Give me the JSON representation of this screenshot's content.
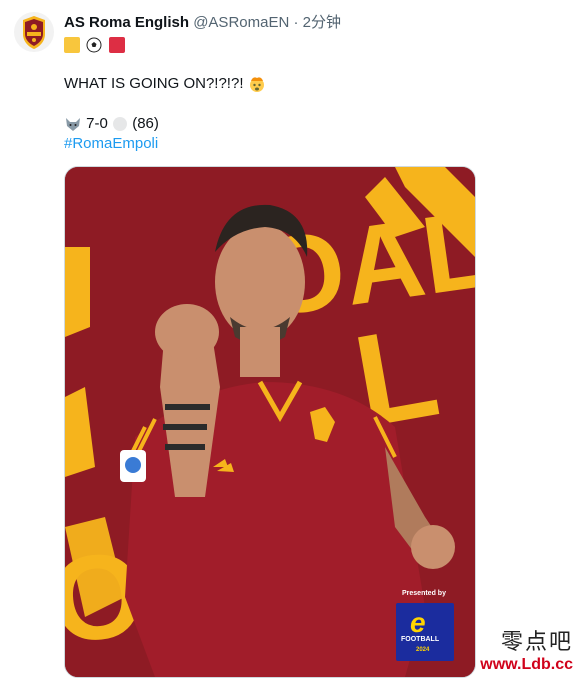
{
  "account": {
    "name": "AS Roma English",
    "handle": "@ASRomaEN",
    "separator": "·",
    "time": "2分钟"
  },
  "tweet": {
    "flag_emojis": [
      "yellow-square",
      "soccer-ball",
      "red-square"
    ],
    "line1": "WHAT IS GOING ON?!?!?!",
    "line1_emoji": "exploding-head",
    "score_text": "7-0",
    "score_extra": "(86)",
    "hashtag": "#RomaEmpoli"
  },
  "media": {
    "headline_words": [
      "GOAL",
      "GOAL",
      "GOAL"
    ],
    "presented_by": "Presented by",
    "sponsor_name": "FOOTBALL",
    "sponsor_year": "2024",
    "sponsor_mark": "e"
  },
  "watermark": {
    "cn": "零点吧",
    "url": "www.Ldb.cc"
  },
  "colors": {
    "roma_red": "#8e1b24",
    "roma_yellow": "#f6b41c",
    "link": "#1d9bf0",
    "efootball_blue": "#1b2c9e"
  }
}
